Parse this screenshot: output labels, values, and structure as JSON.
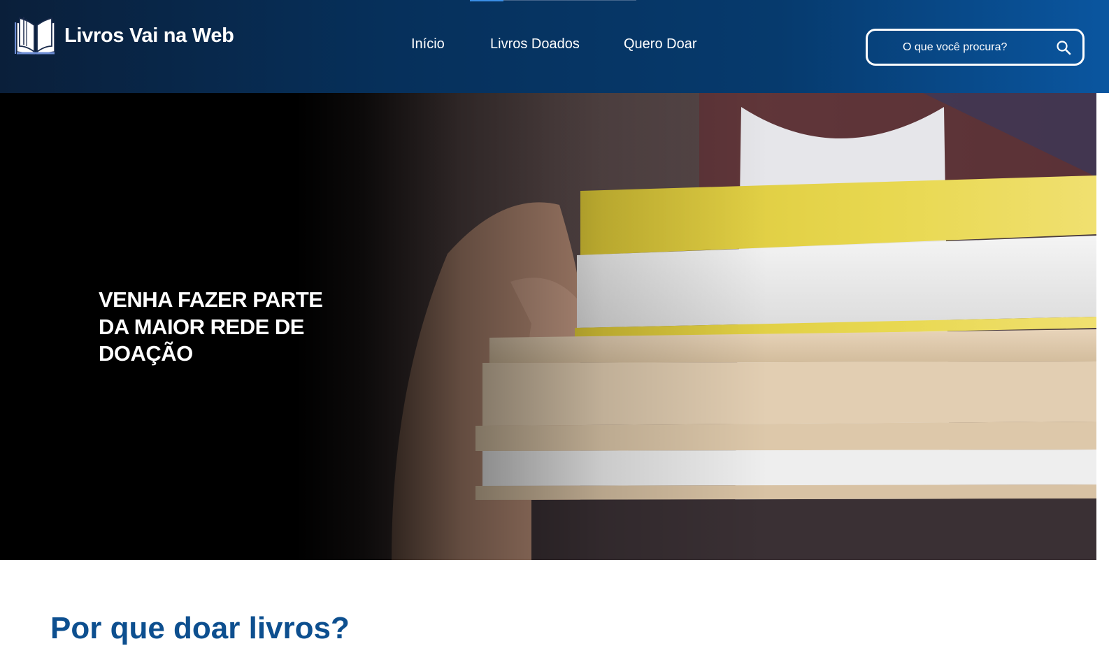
{
  "header": {
    "brand_name": "Livros Vai na Web",
    "logo_icon": "open-book-icon",
    "nav": [
      {
        "label": "Início"
      },
      {
        "label": "Livros Doados"
      },
      {
        "label": "Quero Doar"
      }
    ],
    "search": {
      "placeholder": "O que você procura?",
      "icon": "search-icon"
    },
    "colors": {
      "gradient_start": "#0a1f3a",
      "gradient_end": "#0a56a0",
      "indicator": "#3a8ee6"
    }
  },
  "hero": {
    "title": "VENHA FAZER PARTE DA MAIOR REDE DE DOAÇÃO"
  },
  "section": {
    "heading": "Por que doar livros?",
    "heading_color": "#0d4f8f"
  }
}
